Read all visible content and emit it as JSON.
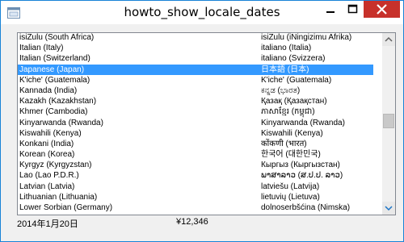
{
  "window": {
    "title": "howto_show_locale_dates"
  },
  "locales": [
    {
      "english": "isiZulu (South Africa)",
      "native": "isiZulu (iNingizimu Afrika)"
    },
    {
      "english": "Italian (Italy)",
      "native": "italiano (Italia)"
    },
    {
      "english": "Italian (Switzerland)",
      "native": "italiano (Svizzera)"
    },
    {
      "english": "Japanese (Japan)",
      "native": "日本語 (日本)",
      "selected": true
    },
    {
      "english": "K'iche' (Guatemala)",
      "native": "K'iche' (Guatemala)"
    },
    {
      "english": "Kannada (India)",
      "native": "ಕನ್ನಡ (ಭಾರತ)"
    },
    {
      "english": "Kazakh (Kazakhstan)",
      "native": "Қазақ (Қазақстан)"
    },
    {
      "english": "Khmer (Cambodia)",
      "native": "ភាសាខ្មែរ (កម្ពុជា)"
    },
    {
      "english": "Kinyarwanda (Rwanda)",
      "native": "Kinyarwanda (Rwanda)"
    },
    {
      "english": "Kiswahili (Kenya)",
      "native": "Kiswahili (Kenya)"
    },
    {
      "english": "Konkani (India)",
      "native": "कोंकणी (भारत)"
    },
    {
      "english": "Korean (Korea)",
      "native": "한국어 (대한민국)"
    },
    {
      "english": "Kyrgyz (Kyrgyzstan)",
      "native": "Кыргыз (Кыргызстан)"
    },
    {
      "english": "Lao (Lao P.D.R.)",
      "native": "ພາສາລາວ (ສ.ປ.ປ. ລາວ)"
    },
    {
      "english": "Latvian (Latvia)",
      "native": "latviešu (Latvija)"
    },
    {
      "english": "Lithuanian (Lithuania)",
      "native": "lietuvių (Lietuva)"
    },
    {
      "english": "Lower Sorbian (Germany)",
      "native": "dolnoserbšćina (Nimska)"
    }
  ],
  "status": {
    "date": "2014年1月20日",
    "currency": "¥12,346"
  },
  "colors": {
    "selection": "#3399ff",
    "close_button": "#c7312b",
    "window_border": "#1883d7"
  },
  "icons": [
    "app-icon",
    "minimize-icon",
    "maximize-icon",
    "close-icon",
    "scroll-up-arrow-icon",
    "scroll-down-arrow-icon"
  ]
}
